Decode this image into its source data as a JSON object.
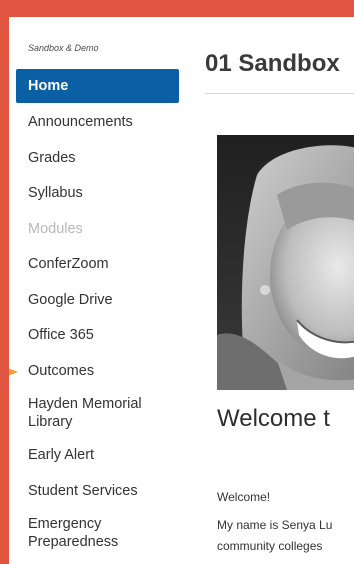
{
  "sidebar": {
    "course_label": "Sandbox & Demo",
    "items": [
      {
        "label": "Home"
      },
      {
        "label": "Announcements"
      },
      {
        "label": "Grades"
      },
      {
        "label": "Syllabus"
      },
      {
        "label": "Modules"
      },
      {
        "label": "ConferZoom"
      },
      {
        "label": "Google Drive"
      },
      {
        "label": "Office 365"
      },
      {
        "label": "Outcomes"
      },
      {
        "label": "Hayden Memorial Library"
      },
      {
        "label": "Early Alert"
      },
      {
        "label": "Student Services"
      },
      {
        "label": "Emergency Preparedness"
      }
    ]
  },
  "main": {
    "page_title": "01 Sandbox",
    "welcome_heading": "Welcome t",
    "welcome_line": "Welcome!",
    "intro_line_1": "My name is Senya Lu",
    "intro_line_2": "community colleges"
  },
  "colors": {
    "frame": "#e0553f",
    "active_nav": "#0b5fa5",
    "pointer": "#f0a030"
  }
}
